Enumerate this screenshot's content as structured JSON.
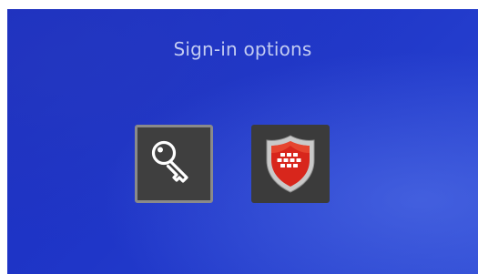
{
  "screen": {
    "title": "Sign-in options"
  },
  "options": [
    {
      "icon": "key-icon",
      "selected": true
    },
    {
      "icon": "shield-firewall-icon",
      "selected": false
    }
  ],
  "colors": {
    "background": "#1f36c8",
    "title_text": "#c3ccf2",
    "tile_background": "#3f3f3f",
    "tile_selected_border": "#8a8a8a",
    "shield_red": "#d8261c",
    "shield_silver": "#c9c9c9"
  }
}
